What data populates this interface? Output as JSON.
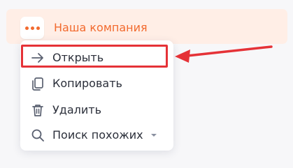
{
  "company": {
    "name": "Наша компания",
    "more_icon": "more-dots-icon"
  },
  "menu": {
    "items": [
      {
        "label": "Открыть",
        "icon": "arrow-right-icon"
      },
      {
        "label": "Копировать",
        "icon": "copy-icon"
      },
      {
        "label": "Удалить",
        "icon": "trash-icon"
      },
      {
        "label": "Поиск похожих",
        "icon": "search-icon",
        "has_dropdown": true
      }
    ]
  },
  "annotation": {
    "highlight_color": "#e53237",
    "target": "Открыть"
  },
  "colors": {
    "accent": "#f26a2e",
    "row_bg": "#ffeee6",
    "text": "#2b2f3a",
    "icon": "#5a6070"
  }
}
